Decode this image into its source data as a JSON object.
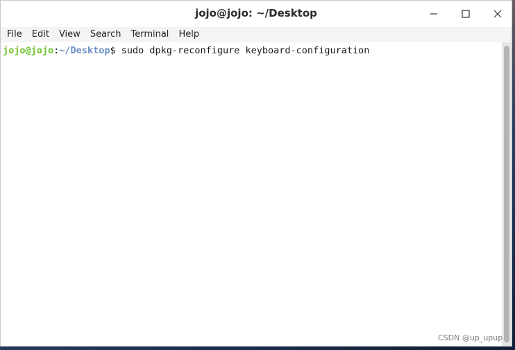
{
  "window": {
    "title": "jojo@jojo: ~/Desktop"
  },
  "window_controls": {
    "minimize_icon": "minimize-icon",
    "maximize_icon": "maximize-icon",
    "close_icon": "close-icon"
  },
  "menu": {
    "items": [
      "File",
      "Edit",
      "View",
      "Search",
      "Terminal",
      "Help"
    ]
  },
  "terminal": {
    "prompt_user": "jojo@jojo",
    "prompt_sep": ":",
    "prompt_path": "~/Desktop",
    "prompt_symbol": "$ ",
    "command": "sudo dpkg-reconfigure keyboard-configuration"
  },
  "colors": {
    "prompt_user": "#6ec42a",
    "prompt_path": "#6a8fc4",
    "terminal_bg": "#ffffff"
  },
  "watermark": "CSDN @up_upup"
}
